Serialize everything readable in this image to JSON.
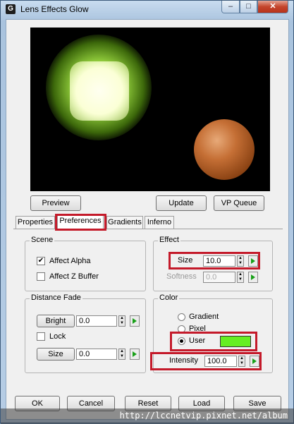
{
  "window": {
    "title": "Lens Effects Glow",
    "app_icon_glyph": "G"
  },
  "preview_buttons": {
    "preview": "Preview",
    "update": "Update",
    "vp_queue": "VP Queue"
  },
  "tabs": [
    {
      "label": "Properties"
    },
    {
      "label": "Preferences",
      "active": true
    },
    {
      "label": "Gradients"
    },
    {
      "label": "Inferno"
    }
  ],
  "scene": {
    "label": "Scene",
    "affect_alpha": {
      "label": "Affect Alpha",
      "checked": true
    },
    "affect_z_buffer": {
      "label": "Affect Z Buffer",
      "checked": false
    }
  },
  "effect": {
    "label": "Effect",
    "size": {
      "label": "Size",
      "value": "10.0"
    },
    "softness": {
      "label": "Softness",
      "value": "0.0"
    }
  },
  "distance_fade": {
    "label": "Distance Fade",
    "bright": {
      "label": "Bright",
      "value": "0.0"
    },
    "lock": {
      "label": "Lock",
      "checked": false
    },
    "size": {
      "label": "Size",
      "value": "0.0"
    }
  },
  "color": {
    "label": "Color",
    "gradient": "Gradient",
    "pixel": "Pixel",
    "user": "User",
    "selected": "User",
    "user_color": "#66ee22",
    "intensity": {
      "label": "Intensity",
      "value": "100.0"
    }
  },
  "footer_buttons": {
    "ok": "OK",
    "cancel": "Cancel",
    "reset": "Reset",
    "load": "Load",
    "save": "Save"
  },
  "watermark": "http://lccnetvip.pixnet.net/album",
  "glyphs": {
    "minimize": "–",
    "maximize": "□",
    "close": "✕",
    "check": "✔",
    "spin_up": "▲",
    "spin_down": "▼"
  },
  "highlight_color": "#c41a2a"
}
